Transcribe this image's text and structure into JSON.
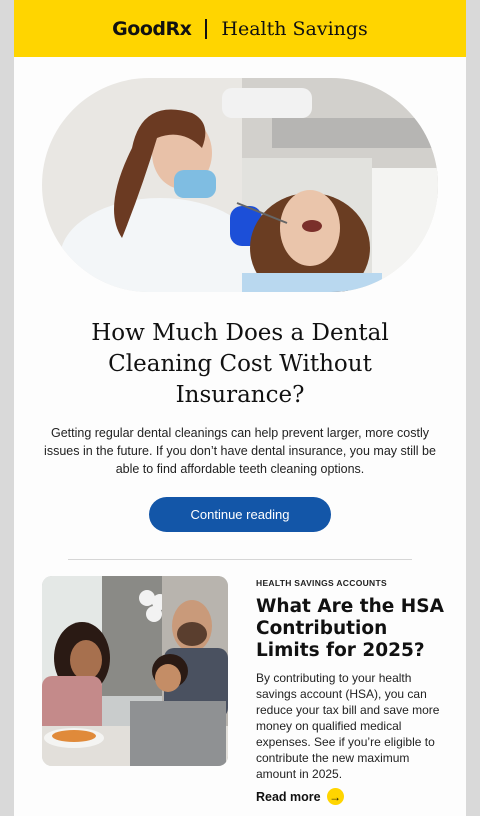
{
  "header": {
    "brand": "GoodRx",
    "tagline": "Health Savings",
    "background": "#ffd500"
  },
  "hero_article": {
    "image": "dentist-cleaning-patient-teeth",
    "title": "How Much Does a Dental Cleaning Cost Without Insurance?",
    "description": "Getting regular dental cleanings can help prevent larger, more costly issues in the future. If you don’t have dental insurance, you may still be able to find affordable teeth cleaning options.",
    "button_label": "Continue reading",
    "button_color": "#1356a8"
  },
  "secondary_article": {
    "image": "family-at-table-with-laptop",
    "kicker": "HEALTH SAVINGS ACCOUNTS",
    "title": "What Are the HSA Contribution Limits for 2025?",
    "description": "By contributing to your health savings account (HSA), you can reduce your tax bill and save more money on qualified medical expenses. See if you’re eligible to contribute the new maximum amount in 2025.",
    "read_more_label": "Read more",
    "read_more_icon": "arrow-right-icon"
  }
}
